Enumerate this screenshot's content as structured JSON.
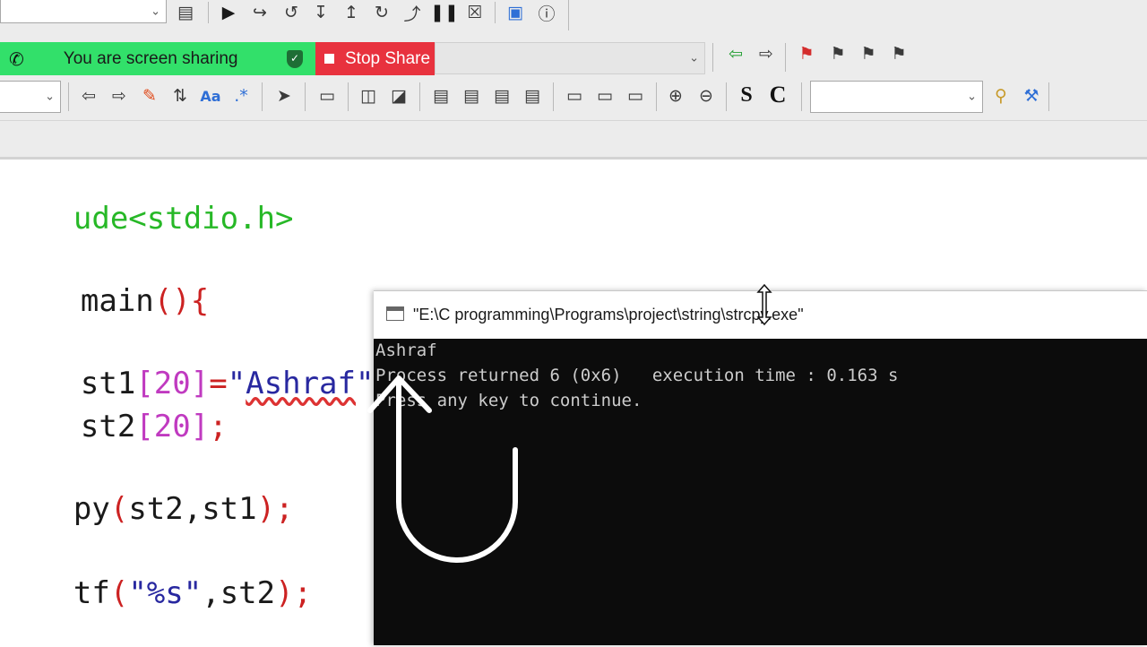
{
  "toolbar": {
    "row1_icons": [
      "document-icon",
      "run-icon",
      "debug-step-icon",
      "debug-next-icon",
      "debug-into-icon",
      "debug-out-icon",
      "debug-continue-icon",
      "debug-break-icon",
      "pause-icon",
      "stop-icon",
      "window-icon",
      "info-icon"
    ],
    "row3_icons": [
      "back-arrow-icon",
      "forward-arrow-icon",
      "highlight-pen-icon",
      "replace-icon",
      "match-case-icon",
      "regex-icon",
      "select-cursor-icon",
      "rectangle-icon",
      "block-icon-1",
      "block-icon-2",
      "align-icon-1",
      "align-icon-2",
      "align-icon-3",
      "align-icon-4",
      "frame-icon-1",
      "frame-icon-2",
      "frame-icon-3",
      "zoom-in-icon",
      "zoom-out-icon"
    ],
    "s_label": "S",
    "c_label": "C",
    "nav_icons": [
      "green-back-arrow-icon",
      "forward-arrow-icon",
      "red-bookmark-icon",
      "bookmark-prev-icon",
      "bookmark-next-icon",
      "bookmark-clear-icon"
    ],
    "search_icons": [
      "search-icon",
      "settings-wrench-icon"
    ]
  },
  "share": {
    "banner_text": "You are screen sharing",
    "stop_label": "Stop Share",
    "colors": {
      "banner": "#32e06a",
      "stop": "#e8323e"
    }
  },
  "editor": {
    "lines": {
      "include": "ude<stdio.h>",
      "main_name": "main",
      "main_paren": "(){",
      "st1_name": "st1",
      "st1_bracket": "[20]",
      "st1_eq": "=",
      "st1_q1": "\"",
      "st1_val": "Ashraf",
      "st1_q2": "\";",
      "st2_name": "st2",
      "st2_bracket": "[20]",
      "st2_semi": ";",
      "cpy_name": "py",
      "cpy_open": "(",
      "cpy_args": "st2,st1",
      "cpy_close": ");",
      "printf_name": "tf",
      "printf_open": "(",
      "printf_fmt": "\"%s\"",
      "printf_comma": ",st2",
      "printf_close": ");"
    },
    "colors": {
      "preprocessor": "#27b827",
      "identifier": "#1a1a1a",
      "number": "#c03ac0",
      "string": "#2828a0",
      "paren": "#cc2222"
    }
  },
  "console": {
    "title": "\"E:\\C programming\\Programs\\project\\string\\strcpy.exe\"",
    "output": [
      "Ashraf",
      "Process returned 6 (0x6)   execution time : 0.163 s",
      "Press any key to continue."
    ]
  }
}
